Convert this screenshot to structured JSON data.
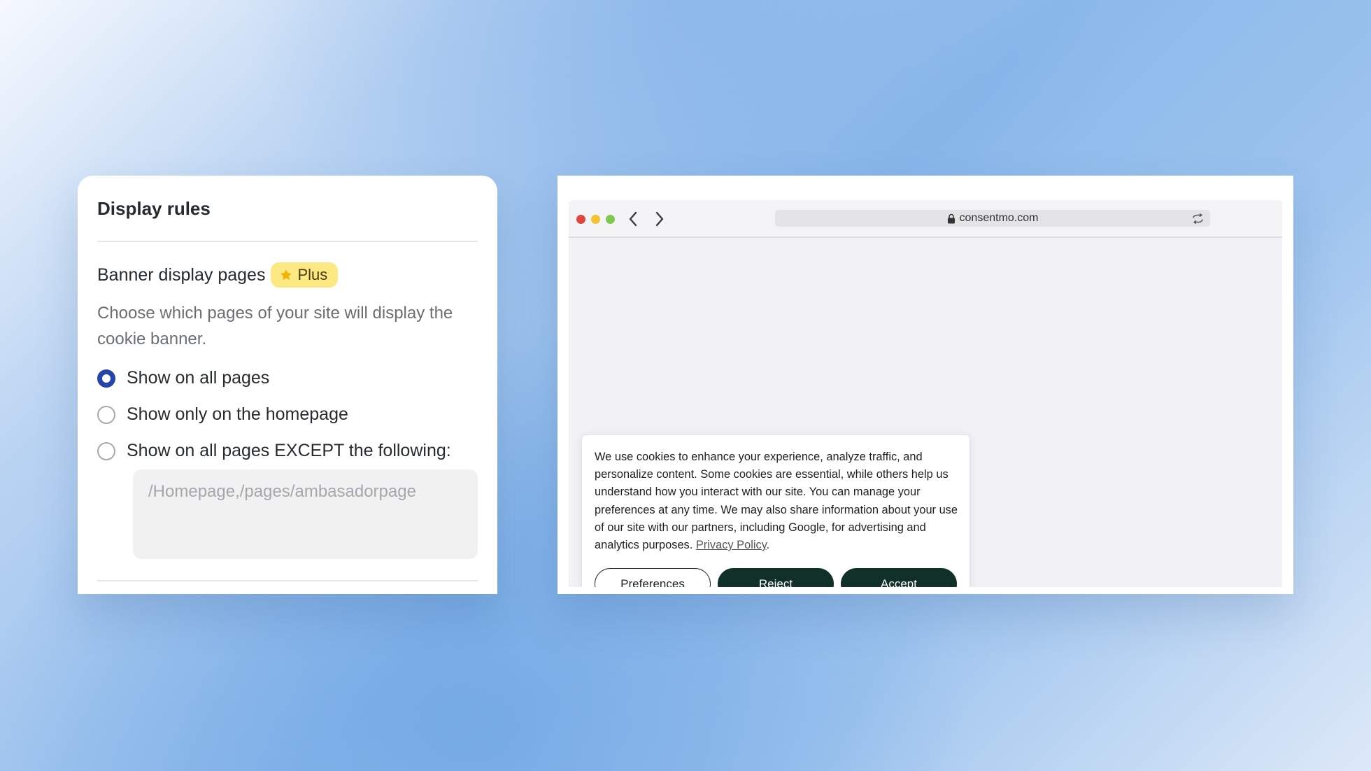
{
  "settings": {
    "title": "Display rules",
    "section_heading": "Banner display pages",
    "badge_label": "Plus",
    "badge_color": "#fde983",
    "description": "Choose which pages of your site will display the cookie banner.",
    "options": [
      {
        "label": "Show on all pages",
        "checked": true
      },
      {
        "label": "Show only on the homepage",
        "checked": false
      },
      {
        "label": "Show on all pages EXCEPT the following:",
        "checked": false
      }
    ],
    "except_placeholder": "/Homepage,/pages/ambasadorpage",
    "accent_color": "#2545a8"
  },
  "browser": {
    "url": "consentmo.com",
    "icons": [
      "back-arrow-icon",
      "forward-arrow-icon",
      "lock-icon",
      "reload-icon"
    ]
  },
  "cookie_banner": {
    "text": "We use cookies to enhance your experience, analyze traffic, and personalize content. Some cookies are essential, while others help us understand how you interact with our site. You can manage your preferences at any time. We may also share information about your use of our site with our partners, including Google, for advertising and analytics purposes.",
    "privacy_link": "Privacy Policy",
    "privacy_suffix": ".",
    "buttons": {
      "preferences": "Preferences",
      "reject": "Reject",
      "accept": "Accept"
    },
    "button_color": "#12302a"
  }
}
